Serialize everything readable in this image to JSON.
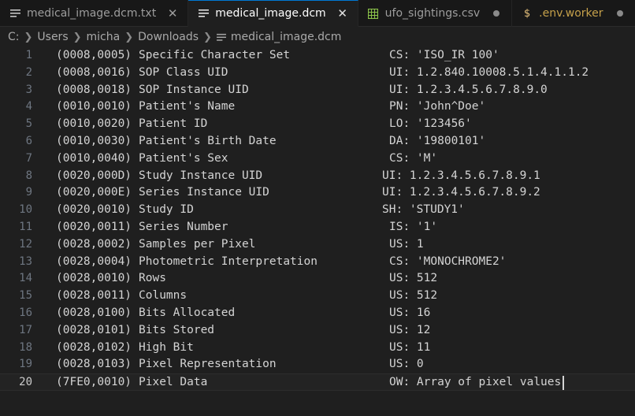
{
  "tabs": [
    {
      "label": "medical_image.dcm.txt",
      "icon": "text-file-icon",
      "control": "close"
    },
    {
      "label": "medical_image.dcm",
      "icon": "text-file-icon",
      "control": "close",
      "active": true
    },
    {
      "label": "ufo_sightings.csv",
      "icon": "spreadsheet-icon",
      "control": "dot"
    },
    {
      "label": ".env.worker",
      "icon": "dollar-icon",
      "control": "dot"
    }
  ],
  "breadcrumb": [
    "C:",
    "Users",
    "micha",
    "Downloads",
    "medical_image.dcm"
  ],
  "lines": [
    {
      "n": "1",
      "tag": "(0008,0005)",
      "name": "Specific Character Set",
      "value": "CS: 'ISO_IR 100'"
    },
    {
      "n": "2",
      "tag": "(0008,0016)",
      "name": "SOP Class UID",
      "value": "UI: 1.2.840.10008.5.1.4.1.1.2"
    },
    {
      "n": "3",
      "tag": "(0008,0018)",
      "name": "SOP Instance UID",
      "value": "UI: 1.2.3.4.5.6.7.8.9.0"
    },
    {
      "n": "4",
      "tag": "(0010,0010)",
      "name": "Patient's Name",
      "value": "PN: 'John^Doe'"
    },
    {
      "n": "5",
      "tag": "(0010,0020)",
      "name": "Patient ID",
      "value": "LO: '123456'"
    },
    {
      "n": "6",
      "tag": "(0010,0030)",
      "name": "Patient's Birth Date",
      "value": "DA: '19800101'"
    },
    {
      "n": "7",
      "tag": "(0010,0040)",
      "name": "Patient's Sex",
      "value": "CS: 'M'"
    },
    {
      "n": "8",
      "tag": "(0020,000D)",
      "name": "Study Instance UID",
      "value": "UI: 1.2.3.4.5.6.7.8.9.1"
    },
    {
      "n": "9",
      "tag": "(0020,000E)",
      "name": "Series Instance UID",
      "value": "UI: 1.2.3.4.5.6.7.8.9.2"
    },
    {
      "n": "10",
      "tag": "(0020,0010)",
      "name": "Study ID",
      "value": "SH: 'STUDY1'"
    },
    {
      "n": "11",
      "tag": "(0020,0011)",
      "name": "Series Number",
      "value": "IS: '1'"
    },
    {
      "n": "12",
      "tag": "(0028,0002)",
      "name": "Samples per Pixel",
      "value": "US: 1"
    },
    {
      "n": "13",
      "tag": "(0028,0004)",
      "name": "Photometric Interpretation",
      "value": "CS: 'MONOCHROME2'"
    },
    {
      "n": "14",
      "tag": "(0028,0010)",
      "name": "Rows",
      "value": "US: 512"
    },
    {
      "n": "15",
      "tag": "(0028,0011)",
      "name": "Columns",
      "value": "US: 512"
    },
    {
      "n": "16",
      "tag": "(0028,0100)",
      "name": "Bits Allocated",
      "value": "US: 16"
    },
    {
      "n": "17",
      "tag": "(0028,0101)",
      "name": "Bits Stored",
      "value": "US: 12"
    },
    {
      "n": "18",
      "tag": "(0028,0102)",
      "name": "High Bit",
      "value": "US: 11"
    },
    {
      "n": "19",
      "tag": "(0028,0103)",
      "name": "Pixel Representation",
      "value": "US: 0"
    },
    {
      "n": "20",
      "tag": "(7FE0,0010)",
      "name": "Pixel Data",
      "value": "OW: Array of pixel values",
      "current": true
    }
  ]
}
